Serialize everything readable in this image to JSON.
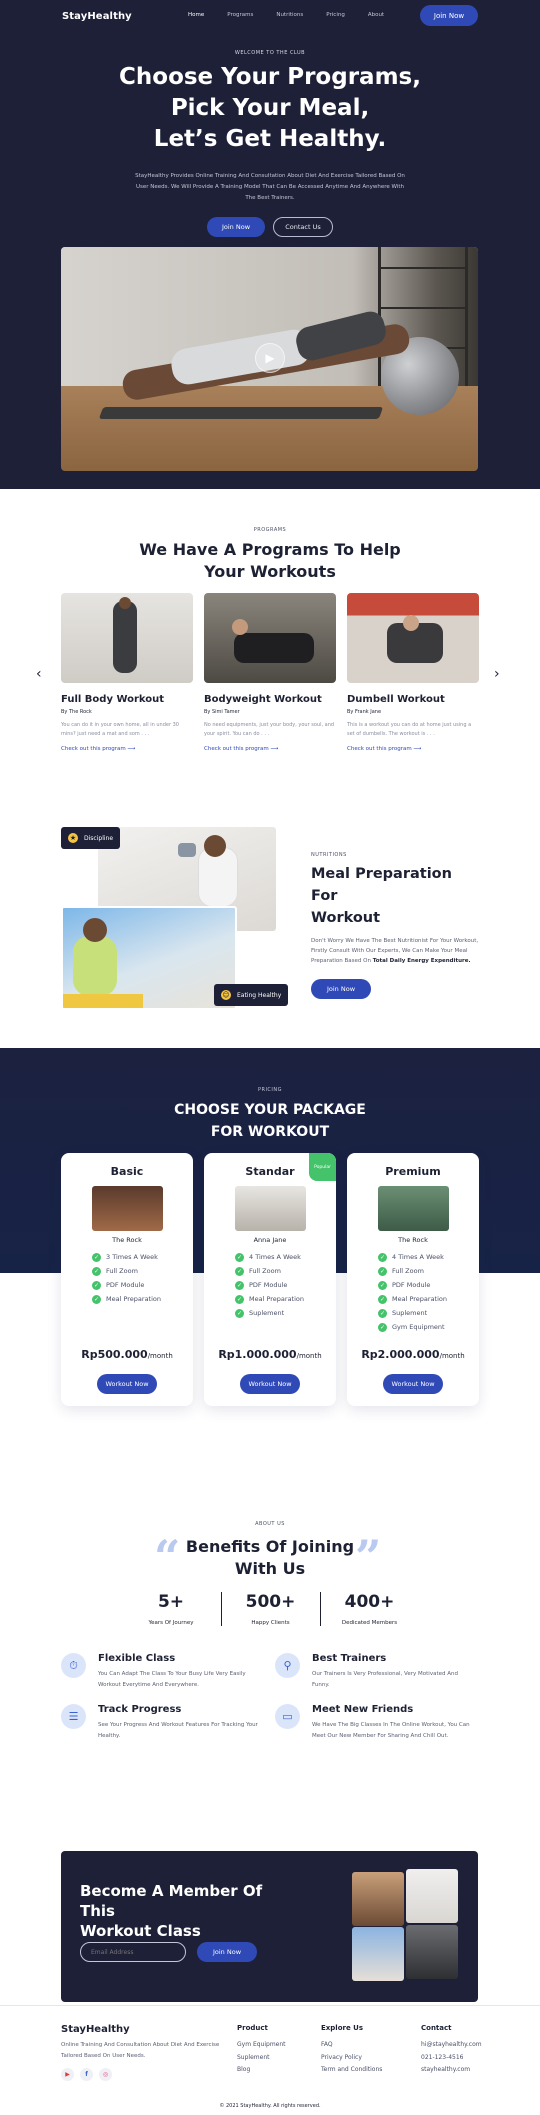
{
  "nav": {
    "brand": "StayHealthy",
    "links": [
      "Home",
      "Programs",
      "Nutritions",
      "Pricing",
      "About"
    ],
    "cta": "Join Now"
  },
  "hero": {
    "kicker": "WELCOME TO THE CLUB",
    "title_line1": "Choose Your Programs,",
    "title_line2": "Pick Your Meal,",
    "title_line3": "Let’s Get Healthy.",
    "description": "StayHealthy Provides Online Training And Consultation About Diet And Exercise Tailored Based On User Needs. We Will Provide A Training Model That Can Be Accessed Anytime And Anywhere With The Best Trainers.",
    "primary_btn": "Join Now",
    "secondary_btn": "Contact Us",
    "play_icon": "play-icon"
  },
  "programs": {
    "kicker": "PROGRAMS",
    "title_line1": "We Have A Programs To Help",
    "title_line2": "Your Workouts",
    "prev_icon": "‹",
    "next_icon": "›",
    "cards": [
      {
        "title": "Full Body Workout",
        "by": "By The Rock",
        "desc": "You can do it in your own home, all in under 30 mins? just need a mat and som . . .",
        "link": "Check out this program"
      },
      {
        "title": "Bodyweight Workout",
        "by": "By Simi Tamer",
        "desc": "No need equipments, just your body, your soul, and your spirit. You can do . . .",
        "link": "Check out this program"
      },
      {
        "title": "Dumbell Workout",
        "by": "By Frank Jane",
        "desc": "This is a workout you can do at home just using a set of dumbells. The workout is . . .",
        "link": "Check out this program"
      }
    ]
  },
  "nutrition": {
    "tag_top": "Discipline",
    "tag_bottom": "Eating Healthy",
    "kicker": "NUTRITIONS",
    "title_line1": "Meal Preparation For",
    "title_line2": "Workout",
    "desc_main": "Don't Worry We Have The Best Nutritionist For Your Workout, Firstly Consult With Our Experts, We Can Make Your Meal Preparation Based On ",
    "desc_bold": "Total Daily Energy Expenditure.",
    "btn": "Join Now"
  },
  "pricing": {
    "kicker": "PRICING",
    "title_line1": "CHOOSE YOUR PACKAGE",
    "title_line2": "FOR WORKOUT",
    "popular_label": "Popular",
    "plans": [
      {
        "name": "Basic",
        "coach": "The Rock",
        "features": [
          "3 Times A Week",
          "Full Zoom",
          "PDF Module",
          "Meal Preparation"
        ],
        "price": "Rp500.000",
        "period": "/month",
        "btn": "Workout Now"
      },
      {
        "name": "Standar",
        "coach": "Anna Jane",
        "features": [
          "4 Times A Week",
          "Full Zoom",
          "PDF Module",
          "Meal Preparation",
          "Suplement"
        ],
        "price": "Rp1.000.000",
        "period": "/month",
        "btn": "Workout Now"
      },
      {
        "name": "Premium",
        "coach": "The Rock",
        "features": [
          "4 Times A Week",
          "Full Zoom",
          "PDF Module",
          "Meal Preparation",
          "Suplement",
          "Gym Equipment"
        ],
        "price": "Rp2.000.000",
        "period": "/month",
        "btn": "Workout Now"
      }
    ]
  },
  "about": {
    "kicker": "ABOUT US",
    "title_line1": "Benefits Of Joining",
    "title_line2": "With Us",
    "stats": [
      {
        "value": "5+",
        "label": "Years Of Journey"
      },
      {
        "value": "500+",
        "label": "Happy Clients"
      },
      {
        "value": "400+",
        "label": "Dedicated Members"
      }
    ],
    "benefits": [
      {
        "icon": "stopwatch-icon",
        "title": "Flexible Class",
        "desc": "You Can Adapt The Class To Your Busy Life Very Easily Workout Everytime And Everywhere."
      },
      {
        "icon": "dumbbell-icon",
        "title": "Best Trainers",
        "desc": "Our Trainers Is Very Professional, Very Motivated And Funny."
      },
      {
        "icon": "clipboard-icon",
        "title": "Track Progress",
        "desc": "See Your Progress And Workout Features For Tracking Your Healthy."
      },
      {
        "icon": "monitor-icon",
        "title": "Meet New Friends",
        "desc": "We Have The Big Classes In The Online Workout, You Can Meet Our New Member For Sharing And Chill Out."
      }
    ]
  },
  "member": {
    "title_line1": "Become A Member Of This",
    "title_line2": "Workout Class",
    "email_placeholder": "Email Address",
    "btn": "Join Now"
  },
  "footer": {
    "brand": "StayHealthy",
    "desc": "Online Training And Consultation About Diet And Exercise Tailored Based On User Needs.",
    "socials": [
      "youtube-icon",
      "facebook-icon",
      "instagram-icon"
    ],
    "columns": [
      {
        "title": "Product",
        "items": [
          "Gym Equipment",
          "Suplement",
          "Blog"
        ]
      },
      {
        "title": "Explore Us",
        "items": [
          "FAQ",
          "Privacy Policy",
          "Term and Conditions"
        ]
      },
      {
        "title": "Contact",
        "items": [
          "hi@stayhealthy.com",
          "021-123-4516",
          "stayhealthy.com"
        ]
      }
    ],
    "copyright": "© 2021 StayHealthy. All rights reserved."
  },
  "colors": {
    "navy": "#1d2036",
    "accent": "#2f49b7",
    "success": "#45c36a",
    "light_blue": "#b9c9ef"
  }
}
